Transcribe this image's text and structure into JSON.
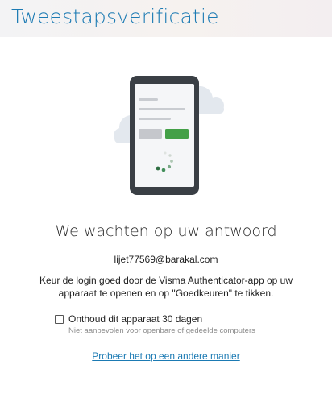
{
  "header": {
    "title": "Tweestapsverificatie"
  },
  "main": {
    "waiting_title": "We wachten op uw antwoord",
    "account": "lijet77569@barakal.com",
    "instruction": "Keur de login goed door de Visma Authenticator-app op uw apparaat te openen en op \"Goedkeuren\" te tikken.",
    "remember": {
      "label": "Onthoud dit apparaat 30 dagen",
      "hint": "Niet aanbevolen voor openbare of gedeelde computers",
      "checked": false
    },
    "alt_link": "Probeer het op een andere manier"
  },
  "colors": {
    "accent": "#1b7ab3",
    "approve_button": "#43a047",
    "reject_button": "#c5c7cc",
    "phone_body": "#3a3f45",
    "cloud": "#e3e8ee"
  },
  "icons": [
    "phone-illustration",
    "cloud-icon",
    "loading-spinner-icon",
    "checkbox"
  ]
}
